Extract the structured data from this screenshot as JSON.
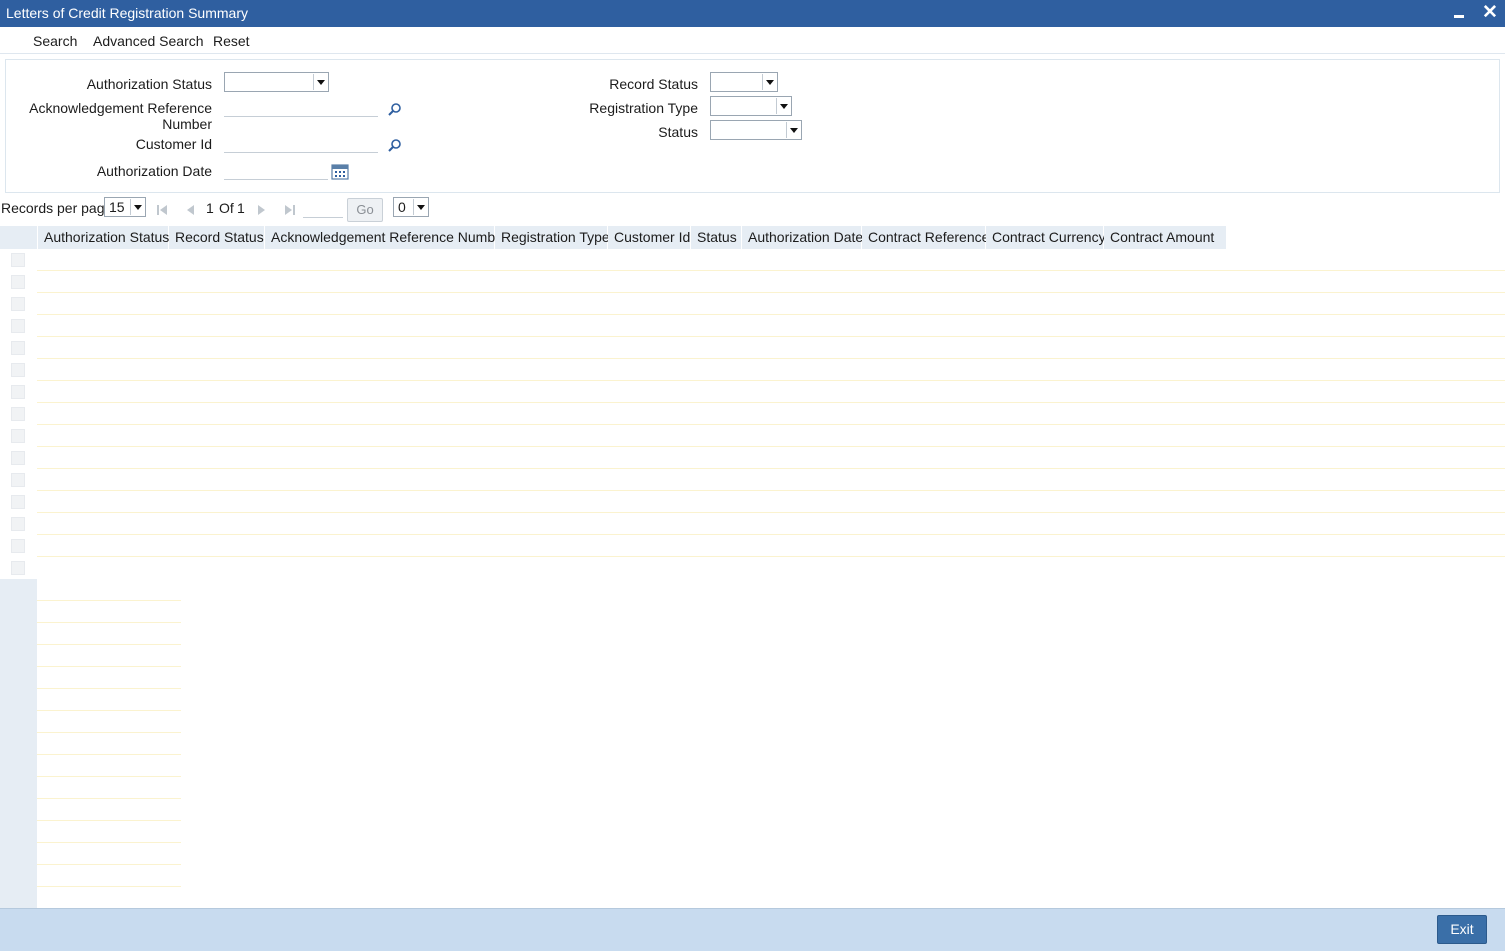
{
  "window": {
    "title": "Letters of Credit Registration Summary",
    "minimize_icon": "minimize-icon",
    "close_icon": "close-icon",
    "close_glyph": "✕"
  },
  "toolbar": {
    "search": "Search",
    "advanced_search": "Advanced Search",
    "reset": "Reset"
  },
  "criteria": {
    "authorization_status": {
      "label": "Authorization Status",
      "value": ""
    },
    "ack_ref_number": {
      "label_line1": "Acknowledgement Reference",
      "label_line2": "Number",
      "value": ""
    },
    "customer_id": {
      "label": "Customer Id",
      "value": ""
    },
    "authorization_date": {
      "label": "Authorization Date",
      "value": ""
    },
    "record_status": {
      "label": "Record Status",
      "value": ""
    },
    "registration_type": {
      "label": "Registration Type",
      "value": ""
    },
    "status": {
      "label": "Status",
      "value": ""
    }
  },
  "pager": {
    "records_per_page_label": "Records per page",
    "records_per_page_value": "15",
    "page_current": "1",
    "page_of": "Of",
    "page_total": "1",
    "go_label": "Go",
    "goto_value": "",
    "extra_select_value": "0"
  },
  "grid": {
    "columns": [
      "Authorization Status",
      "Record Status",
      "Acknowledgement Reference Number",
      "Registration Type",
      "Customer Id",
      "Status",
      "Authorization Date",
      "Contract Reference",
      "Contract Currency",
      "Contract Amount"
    ],
    "rows": []
  },
  "footer": {
    "exit": "Exit"
  },
  "colors": {
    "titlebar": "#2f5fa0",
    "header_bg": "#e6edf4",
    "footer_bg": "#c8dbef",
    "exit_button": "#3a6fa8",
    "row_line": "#fbf3cf"
  }
}
